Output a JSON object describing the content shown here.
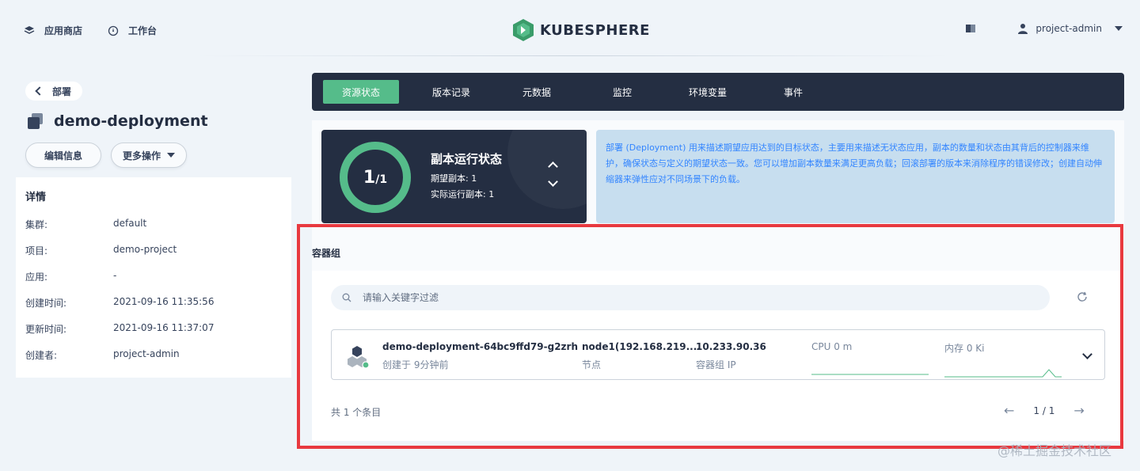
{
  "topbar": {
    "app_store": "应用商店",
    "workbench": "工作台",
    "logo_text": "KUBESPHERE",
    "user": "project-admin"
  },
  "left": {
    "back_label": "部署",
    "title": "demo-deployment",
    "edit_button": "编辑信息",
    "more_button": "更多操作",
    "details_title": "详情",
    "details": [
      {
        "key": "集群:",
        "value": "default"
      },
      {
        "key": "项目:",
        "value": "demo-project"
      },
      {
        "key": "应用:",
        "value": "-"
      },
      {
        "key": "创建时间:",
        "value": "2021-09-16 11:35:56"
      },
      {
        "key": "更新时间:",
        "value": "2021-09-16 11:37:07"
      },
      {
        "key": "创建者:",
        "value": "project-admin"
      }
    ]
  },
  "tabs": [
    "资源状态",
    "版本记录",
    "元数据",
    "监控",
    "环境变量",
    "事件"
  ],
  "status": {
    "ring_value": "1",
    "ring_total": "/1",
    "title": "副本运行状态",
    "desired": "期望副本: 1",
    "actual": "实际运行副本: 1",
    "ready_fraction": 1.0
  },
  "description": "部署 (Deployment) 用来描述期望应用达到的目标状态，主要用来描述无状态应用，副本的数量和状态由其背后的控制器来维护，确保状态与定义的期望状态一致。您可以增加副本数量来满足更高负载；回滚部署的版本来消除程序的错误修改；创建自动伸缩器来弹性应对不同场景下的负载。",
  "pods_section": {
    "title": "容器组",
    "search_placeholder": "请输入关键字过滤",
    "pod": {
      "name": "demo-deployment-64bc9ffd79-g2zrh",
      "created": "创建于 9分钟前",
      "node": "node1(192.168.219....",
      "node_label": "节点",
      "ip": "10.233.90.36",
      "ip_label": "容器组 IP",
      "cpu_label": "CPU 0 m",
      "mem_label": "内存 0 Ki"
    },
    "total": "共 1 个条目",
    "page": "1 / 1"
  },
  "watermark": "@稀土掘金技术社区",
  "colors": {
    "accent": "#55bc8a",
    "dark": "#242e42",
    "highlight": "#e8393f",
    "desc_bg": "#c7deef",
    "desc_text": "#3385ff"
  }
}
